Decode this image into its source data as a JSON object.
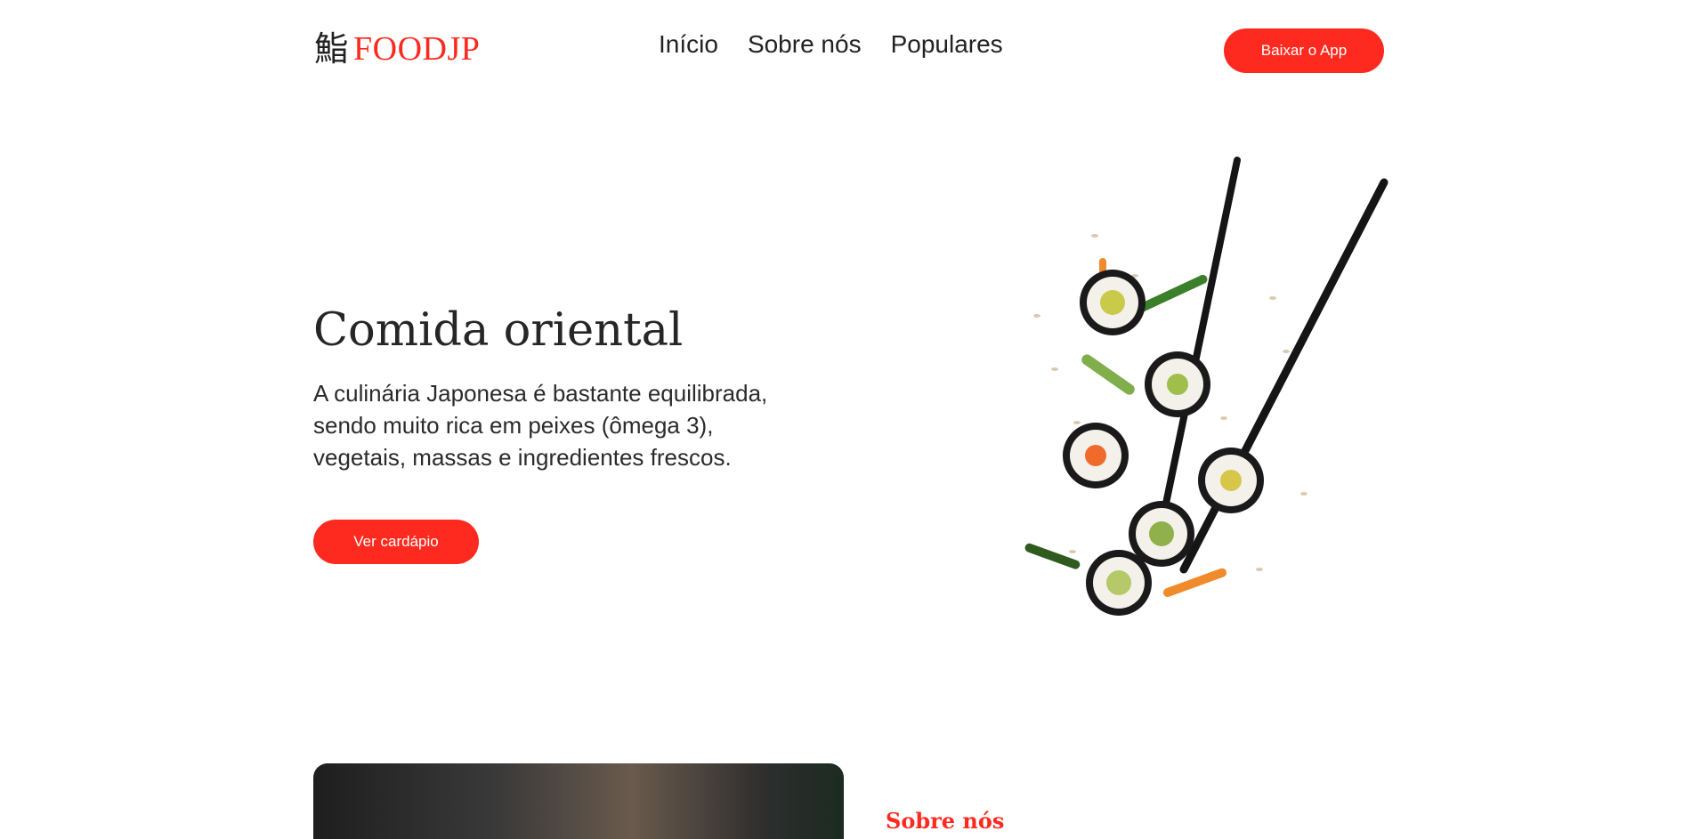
{
  "brand": {
    "kanji": "鮨",
    "name": "FOODJP",
    "accent_color": "#ff2a1f"
  },
  "nav": {
    "items": [
      "Início",
      "Sobre nós",
      "Populares"
    ]
  },
  "header": {
    "app_button_label": "Baixar o App"
  },
  "hero": {
    "title": "Comida oriental",
    "text": "A culinária Japonesa é bastante equilibrada, sendo muito rica em peixes (ômega 3), vegetais, massas e ingredientes frescos.",
    "menu_button_label": "Ver cardápio",
    "image_icon": "sushi-chopsticks-illustration"
  },
  "about": {
    "label": "Sobre nós"
  }
}
